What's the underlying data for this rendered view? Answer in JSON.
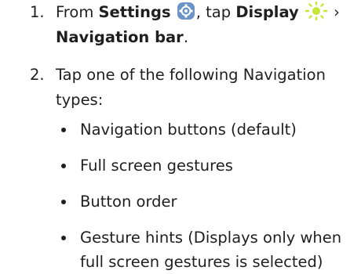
{
  "steps": [
    {
      "number": "1.",
      "from": "From",
      "settings": "Settings",
      "settings_icon": "gear-icon",
      "tap": ", tap",
      "display": "Display",
      "display_icon": "sun-icon",
      "arrow": "›",
      "navigation_bar": "Navigation bar",
      "period": "."
    },
    {
      "number": "2.",
      "line1": "Tap one of the following Navigation",
      "line2": "types:"
    }
  ],
  "options": [
    {
      "line1": "Navigation buttons (default)"
    },
    {
      "line1": "Full screen gestures"
    },
    {
      "line1": "Button order"
    },
    {
      "line1": "Gesture hints (Displays only when",
      "line2": "full screen gestures is selected)"
    }
  ],
  "colors": {
    "settings_icon": "#6b93c8",
    "display_icon": "#c6e63a"
  }
}
